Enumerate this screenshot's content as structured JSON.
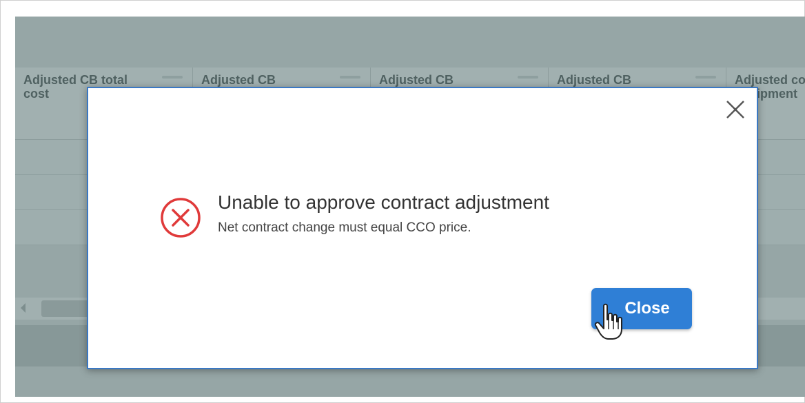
{
  "grid": {
    "columns": [
      {
        "label": "Adjusted CB total cost"
      },
      {
        "label": "Adjusted CB"
      },
      {
        "label": "Adjusted CB"
      },
      {
        "label": "Adjusted CB"
      },
      {
        "label": "Adjusted construct equipment"
      }
    ]
  },
  "dialog": {
    "title": "Unable to approve contract adjustment",
    "message": "Net contract change must equal CCO price.",
    "close_button_label": "Close",
    "icons": {
      "status": "error-circle-x-icon",
      "dismiss": "close-icon",
      "cursor": "hand-pointer-icon"
    },
    "colors": {
      "error": "#e03a3a",
      "primary": "#2f7fd6",
      "border": "#3a78c4"
    }
  }
}
